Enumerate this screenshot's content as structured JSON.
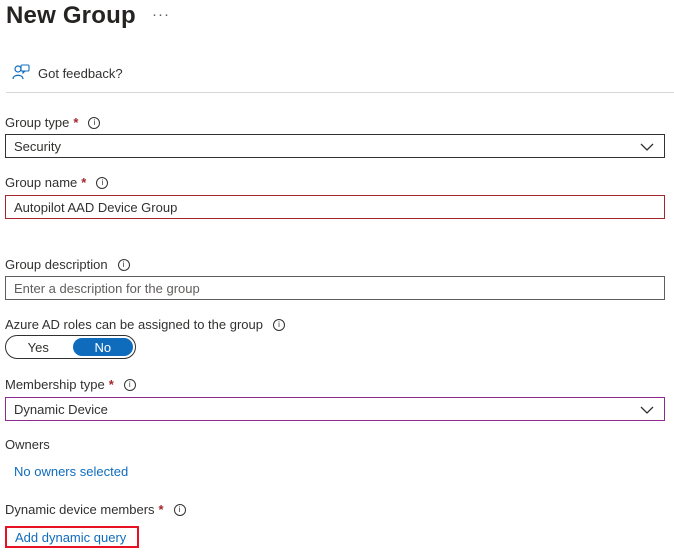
{
  "header": {
    "title": "New Group",
    "more": "···"
  },
  "feedback": {
    "label": "Got feedback?"
  },
  "fields": {
    "group_type": {
      "label": "Group type",
      "required": "*",
      "value": "Security"
    },
    "group_name": {
      "label": "Group name",
      "required": "*",
      "value": "Autopilot AAD Device Group"
    },
    "group_description": {
      "label": "Group description",
      "placeholder": "Enter a description for the group"
    },
    "azure_roles": {
      "label": "Azure AD roles can be assigned to the group",
      "options": [
        "Yes",
        "No"
      ],
      "selected": "No"
    },
    "membership_type": {
      "label": "Membership type",
      "required": "*",
      "value": "Dynamic Device"
    },
    "owners": {
      "label": "Owners",
      "link": "No owners selected"
    },
    "dynamic_members": {
      "label": "Dynamic device members",
      "required": "*",
      "link": "Add dynamic query"
    }
  },
  "info_glyph": "i",
  "colors": {
    "accent": "#0f6cbd",
    "required": "#a4262c",
    "highlight": "#e81123",
    "purple_border": "#8a2b8d"
  }
}
